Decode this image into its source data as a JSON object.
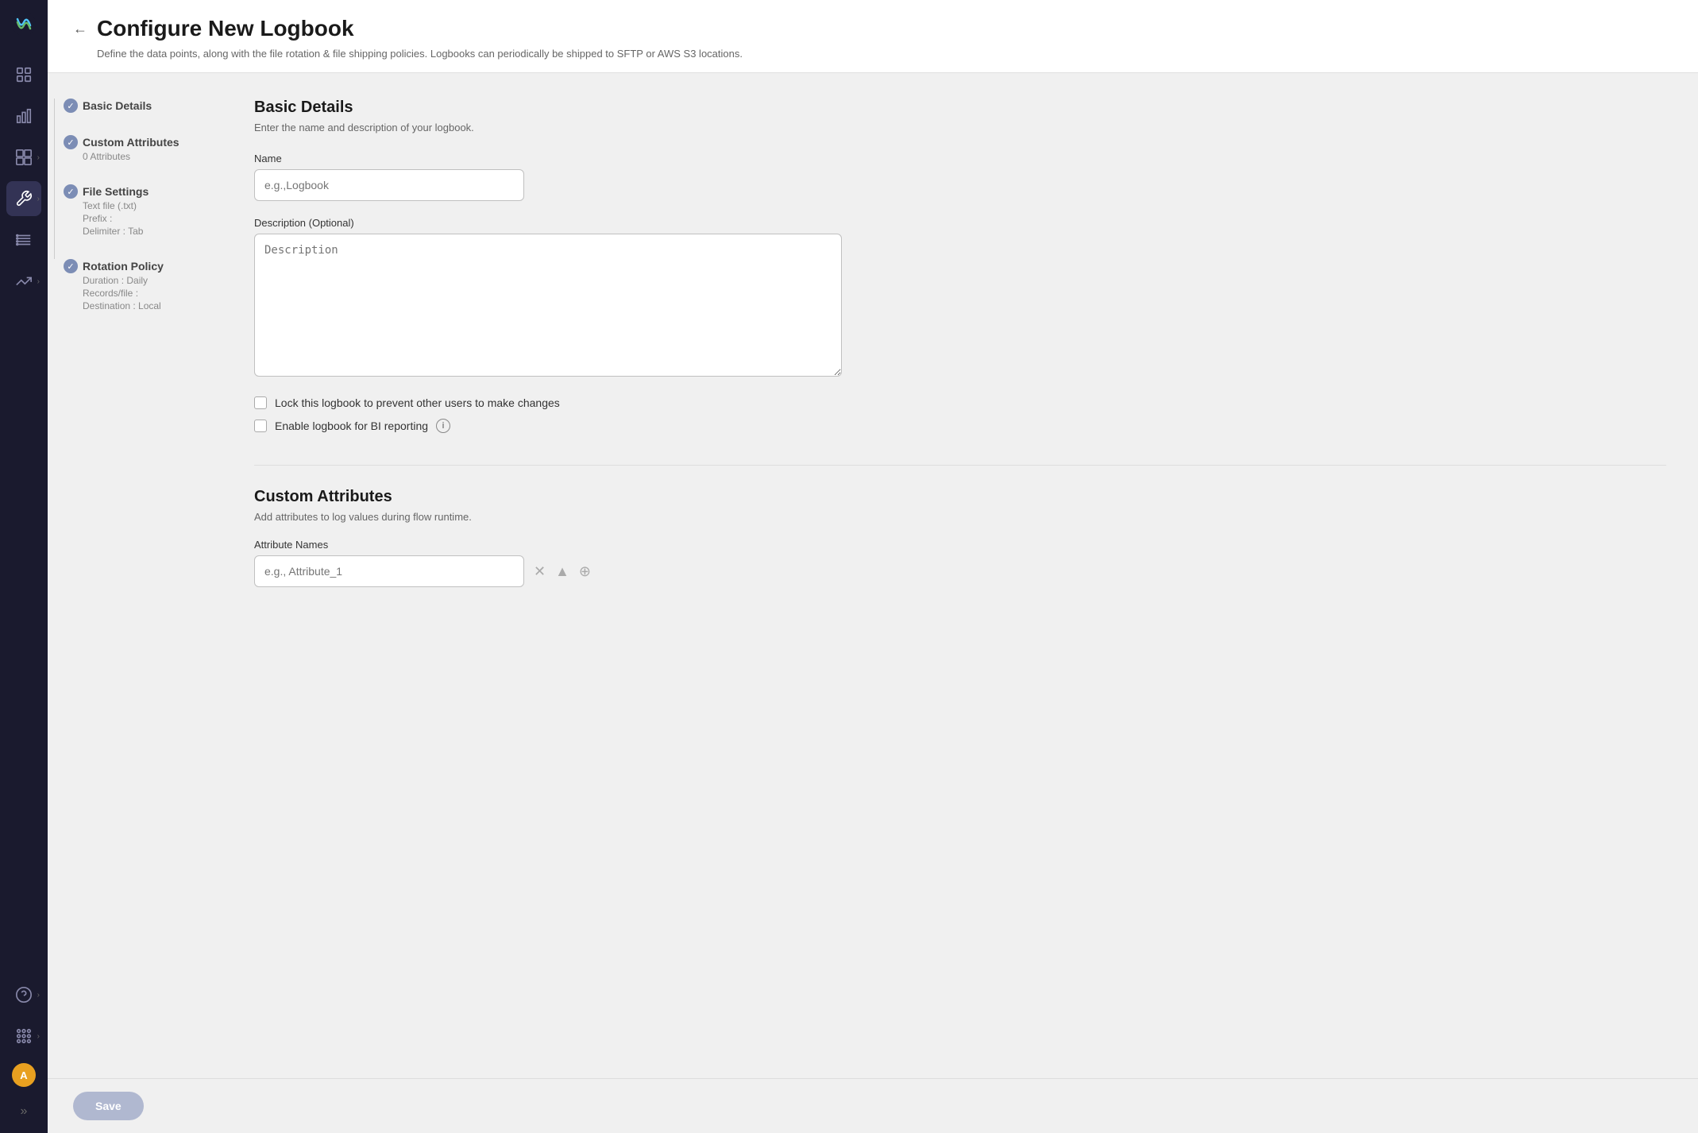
{
  "app": {
    "logo_text": "W",
    "title": "Configure New Logbook",
    "subtitle": "Define the data points, along with the file rotation & file shipping policies. Logbooks can periodically be shipped to SFTP or AWS S3 locations.",
    "back_label": "←"
  },
  "sidebar": {
    "avatar_label": "A",
    "expand_icon": "»",
    "nav_items": [
      {
        "id": "dashboard",
        "icon": "⊞",
        "active": false,
        "has_chevron": false
      },
      {
        "id": "analytics",
        "icon": "📊",
        "active": false,
        "has_chevron": false
      },
      {
        "id": "widgets",
        "icon": "⊡",
        "active": false,
        "has_chevron": true
      },
      {
        "id": "wrench",
        "icon": "🔧",
        "active": true,
        "has_chevron": true
      },
      {
        "id": "list",
        "icon": "≡",
        "active": false,
        "has_chevron": false
      },
      {
        "id": "trending",
        "icon": "↗",
        "active": false,
        "has_chevron": true
      }
    ]
  },
  "steps": [
    {
      "id": "basic-details",
      "label": "Basic Details",
      "details": []
    },
    {
      "id": "custom-attributes",
      "label": "Custom Attributes",
      "details": [
        "0 Attributes"
      ]
    },
    {
      "id": "file-settings",
      "label": "File Settings",
      "details": [
        "Text file (.txt)",
        "Prefix :",
        "Delimiter : Tab"
      ]
    },
    {
      "id": "rotation-policy",
      "label": "Rotation Policy",
      "details": [
        "Duration : Daily",
        "Records/file :",
        "Destination : Local"
      ]
    }
  ],
  "basic_details": {
    "section_title": "Basic Details",
    "section_subtitle": "Enter the name and description of your logbook.",
    "name_label": "Name",
    "name_placeholder": "e.g.,Logbook",
    "description_label": "Description (Optional)",
    "description_placeholder": "Description",
    "lock_label": "Lock this logbook to prevent other users to make changes",
    "bi_label": "Enable logbook for BI reporting",
    "info_icon": "i"
  },
  "custom_attributes": {
    "section_title": "Custom Attributes",
    "section_subtitle": "Add attributes to log values during flow runtime.",
    "attribute_names_label": "Attribute Names",
    "attribute_placeholder": "e.g., Attribute_1"
  },
  "footer": {
    "save_label": "Save"
  }
}
